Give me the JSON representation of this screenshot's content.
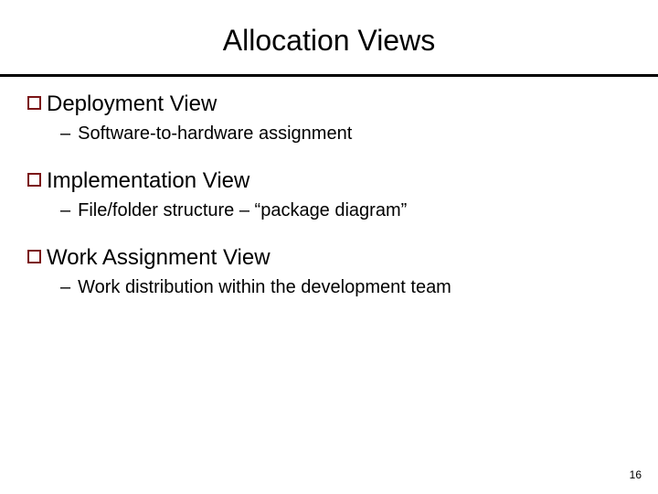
{
  "slide": {
    "title": "Allocation Views",
    "items": [
      {
        "heading": "Deployment View",
        "sub": "Software-to-hardware assignment"
      },
      {
        "heading": "Implementation View",
        "sub": "File/folder structure – “package diagram”"
      },
      {
        "heading": "Work Assignment View",
        "sub": "Work distribution within the development team"
      }
    ],
    "page_number": "16"
  }
}
